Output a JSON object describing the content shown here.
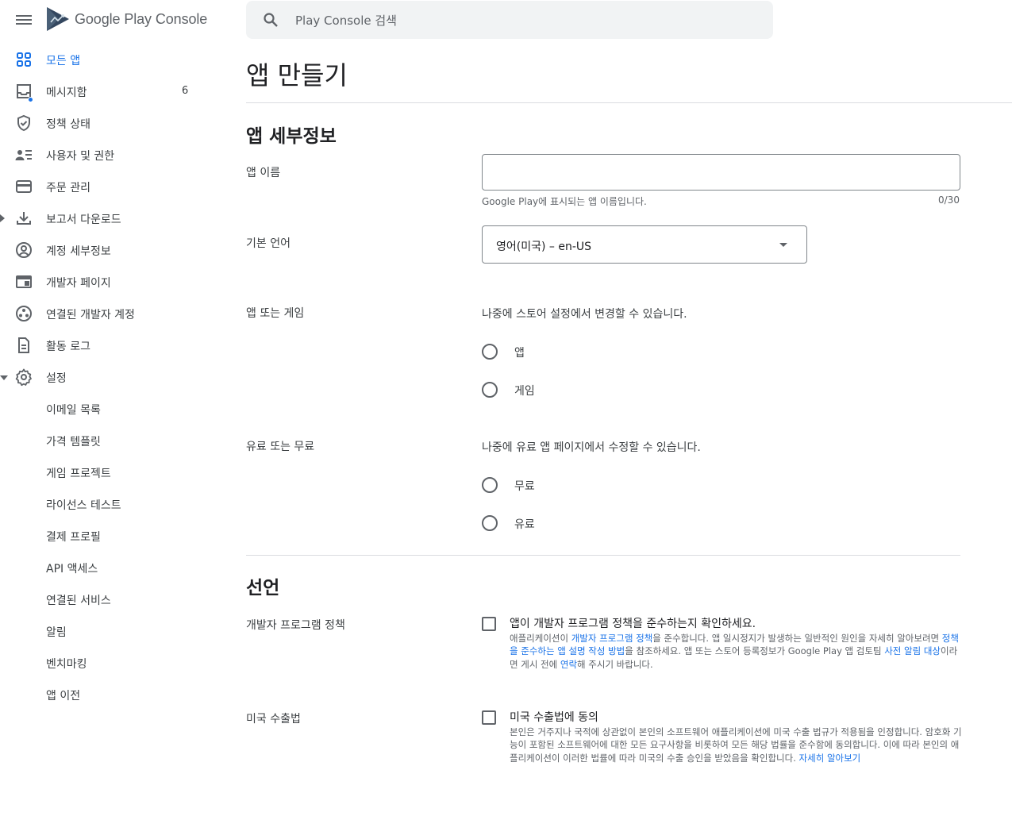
{
  "app": {
    "logo_text": "Google Play Console"
  },
  "search": {
    "placeholder": "Play Console 검색"
  },
  "sidebar": {
    "items": [
      {
        "label": "모든 앱",
        "icon": "apps-grid-icon"
      },
      {
        "label": "메시지함",
        "icon": "inbox-icon",
        "count": "6"
      },
      {
        "label": "정책 상태",
        "icon": "shield-check-icon"
      },
      {
        "label": "사용자 및 권한",
        "icon": "people-list-icon"
      },
      {
        "label": "주문 관리",
        "icon": "credit-card-icon"
      },
      {
        "label": "보고서 다운로드",
        "icon": "download-icon"
      },
      {
        "label": "계정 세부정보",
        "icon": "account-circle-icon"
      },
      {
        "label": "개발자 페이지",
        "icon": "web-page-icon"
      },
      {
        "label": "연결된 개발자 계정",
        "icon": "linked-accounts-icon"
      },
      {
        "label": "활동 로그",
        "icon": "document-icon"
      },
      {
        "label": "설정",
        "icon": "gear-icon"
      },
      {
        "label": "이메일 목록"
      },
      {
        "label": "가격 템플릿"
      },
      {
        "label": "게임 프로젝트"
      },
      {
        "label": "라이선스 테스트"
      },
      {
        "label": "결제 프로필"
      },
      {
        "label": "API 액세스"
      },
      {
        "label": "연결된 서비스"
      },
      {
        "label": "알림"
      },
      {
        "label": "벤치마킹"
      },
      {
        "label": "앱 이전"
      }
    ]
  },
  "main": {
    "title": "앱 만들기",
    "details_section": {
      "title": "앱 세부정보",
      "app_name_label": "앱 이름",
      "app_name_value": "",
      "app_name_helper": "Google Play에 표시되는 앱 이름입니다.",
      "app_name_counter": "0/30",
      "language_label": "기본 언어",
      "language_value": "영어(미국) – en-US",
      "app_or_game_label": "앱 또는 게임",
      "app_or_game_note": "나중에 스토어 설정에서 변경할 수 있습니다.",
      "app_or_game_options": [
        "앱",
        "게임"
      ],
      "free_or_paid_label": "유료 또는 무료",
      "free_or_paid_note": "나중에 유료 앱 페이지에서 수정할 수 있습니다.",
      "free_or_paid_options": [
        "무료",
        "유료"
      ]
    },
    "declarations_section": {
      "title": "선언",
      "policy_label": "개발자 프로그램 정책",
      "policy_checkbox": "앱이 개발자 프로그램 정책을 준수하는지 확인하세요.",
      "policy_desc": {
        "p1": "애플리케이션이 ",
        "link1": "개발자 프로그램 정책",
        "p2": "을 준수합니다. 앱 일시정지가 발생하는 일반적인 원인을 자세히 알아보려면 ",
        "link2": "정책을 준수하는 앱 설명 작성 방법",
        "p3": "을 참조하세요. 앱 또는 스토어 등록정보가 Google Play 앱 검토팀 ",
        "link3": "사전 알림 대상",
        "p4": "이라면 게시 전에 ",
        "link4": "연락",
        "p5": "해 주시기 바랍니다."
      },
      "export_label": "미국 수출법",
      "export_checkbox": "미국 수출법에 동의",
      "export_desc": {
        "p1": "본인은 거주지나 국적에 상관없이 본인의 소프트웨어 애플리케이션에 미국 수출 법규가 적용됨을 인정합니다. 암호화 기능이 포함된 소프트웨어에 대한 모든 요구사항을 비롯하여 모든 해당 법률을 준수함에 동의합니다. 이에 따라 본인의 애플리케이션이 이러한 법률에 따라 미국의 수출 승인을 받았음을 확인합니다. ",
        "link1": "자세히 알아보기"
      }
    }
  },
  "colors": {
    "accent": "#1a73e8",
    "text": "#202124",
    "muted": "#5f6368",
    "divider": "#dadce0",
    "search_bg": "#f1f3f4"
  }
}
